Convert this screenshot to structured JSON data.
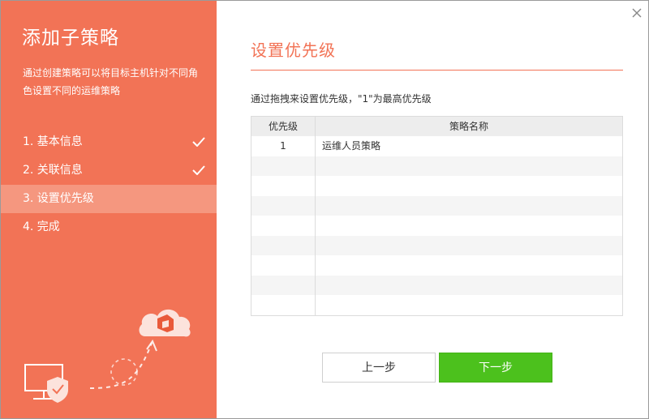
{
  "wizard": {
    "title": "添加子策略",
    "description": "通过创建策略可以将目标主机针对不同角色设置不同的运维策略",
    "steps": [
      {
        "label": "1. 基本信息",
        "completed": true
      },
      {
        "label": "2. 关联信息",
        "completed": true
      },
      {
        "label": "3. 设置优先级",
        "active": true
      },
      {
        "label": "4. 完成"
      }
    ]
  },
  "main": {
    "heading": "设置优先级",
    "hint": "通过拖拽来设置优先级，\"1\"为最高优先级",
    "table": {
      "headers": [
        "优先级",
        "策略名称"
      ],
      "rows": [
        {
          "priority": "1",
          "name": "运维人员策略"
        },
        {
          "priority": "",
          "name": ""
        },
        {
          "priority": "",
          "name": ""
        },
        {
          "priority": "",
          "name": ""
        },
        {
          "priority": "",
          "name": ""
        },
        {
          "priority": "",
          "name": ""
        },
        {
          "priority": "",
          "name": ""
        },
        {
          "priority": "",
          "name": ""
        },
        {
          "priority": "",
          "name": ""
        }
      ]
    }
  },
  "buttons": {
    "prev": "上一步",
    "next": "下一步"
  },
  "colors": {
    "accent": "#f27356",
    "active_step": "#f5977f",
    "next_button": "#4cc11d"
  }
}
